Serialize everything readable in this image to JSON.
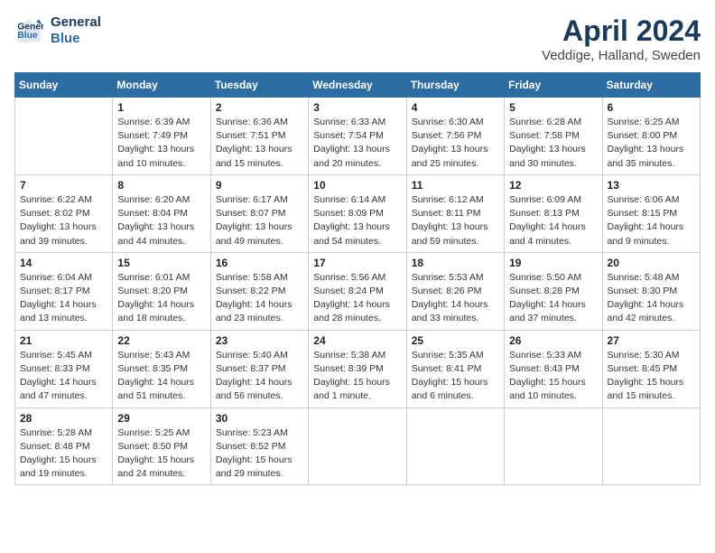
{
  "header": {
    "logo_line1": "General",
    "logo_line2": "Blue",
    "month_title": "April 2024",
    "location": "Veddige, Halland, Sweden"
  },
  "weekdays": [
    "Sunday",
    "Monday",
    "Tuesday",
    "Wednesday",
    "Thursday",
    "Friday",
    "Saturday"
  ],
  "weeks": [
    [
      {
        "day": "",
        "info": ""
      },
      {
        "day": "1",
        "info": "Sunrise: 6:39 AM\nSunset: 7:49 PM\nDaylight: 13 hours\nand 10 minutes."
      },
      {
        "day": "2",
        "info": "Sunrise: 6:36 AM\nSunset: 7:51 PM\nDaylight: 13 hours\nand 15 minutes."
      },
      {
        "day": "3",
        "info": "Sunrise: 6:33 AM\nSunset: 7:54 PM\nDaylight: 13 hours\nand 20 minutes."
      },
      {
        "day": "4",
        "info": "Sunrise: 6:30 AM\nSunset: 7:56 PM\nDaylight: 13 hours\nand 25 minutes."
      },
      {
        "day": "5",
        "info": "Sunrise: 6:28 AM\nSunset: 7:58 PM\nDaylight: 13 hours\nand 30 minutes."
      },
      {
        "day": "6",
        "info": "Sunrise: 6:25 AM\nSunset: 8:00 PM\nDaylight: 13 hours\nand 35 minutes."
      }
    ],
    [
      {
        "day": "7",
        "info": "Sunrise: 6:22 AM\nSunset: 8:02 PM\nDaylight: 13 hours\nand 39 minutes."
      },
      {
        "day": "8",
        "info": "Sunrise: 6:20 AM\nSunset: 8:04 PM\nDaylight: 13 hours\nand 44 minutes."
      },
      {
        "day": "9",
        "info": "Sunrise: 6:17 AM\nSunset: 8:07 PM\nDaylight: 13 hours\nand 49 minutes."
      },
      {
        "day": "10",
        "info": "Sunrise: 6:14 AM\nSunset: 8:09 PM\nDaylight: 13 hours\nand 54 minutes."
      },
      {
        "day": "11",
        "info": "Sunrise: 6:12 AM\nSunset: 8:11 PM\nDaylight: 13 hours\nand 59 minutes."
      },
      {
        "day": "12",
        "info": "Sunrise: 6:09 AM\nSunset: 8:13 PM\nDaylight: 14 hours\nand 4 minutes."
      },
      {
        "day": "13",
        "info": "Sunrise: 6:06 AM\nSunset: 8:15 PM\nDaylight: 14 hours\nand 9 minutes."
      }
    ],
    [
      {
        "day": "14",
        "info": "Sunrise: 6:04 AM\nSunset: 8:17 PM\nDaylight: 14 hours\nand 13 minutes."
      },
      {
        "day": "15",
        "info": "Sunrise: 6:01 AM\nSunset: 8:20 PM\nDaylight: 14 hours\nand 18 minutes."
      },
      {
        "day": "16",
        "info": "Sunrise: 5:58 AM\nSunset: 8:22 PM\nDaylight: 14 hours\nand 23 minutes."
      },
      {
        "day": "17",
        "info": "Sunrise: 5:56 AM\nSunset: 8:24 PM\nDaylight: 14 hours\nand 28 minutes."
      },
      {
        "day": "18",
        "info": "Sunrise: 5:53 AM\nSunset: 8:26 PM\nDaylight: 14 hours\nand 33 minutes."
      },
      {
        "day": "19",
        "info": "Sunrise: 5:50 AM\nSunset: 8:28 PM\nDaylight: 14 hours\nand 37 minutes."
      },
      {
        "day": "20",
        "info": "Sunrise: 5:48 AM\nSunset: 8:30 PM\nDaylight: 14 hours\nand 42 minutes."
      }
    ],
    [
      {
        "day": "21",
        "info": "Sunrise: 5:45 AM\nSunset: 8:33 PM\nDaylight: 14 hours\nand 47 minutes."
      },
      {
        "day": "22",
        "info": "Sunrise: 5:43 AM\nSunset: 8:35 PM\nDaylight: 14 hours\nand 51 minutes."
      },
      {
        "day": "23",
        "info": "Sunrise: 5:40 AM\nSunset: 8:37 PM\nDaylight: 14 hours\nand 56 minutes."
      },
      {
        "day": "24",
        "info": "Sunrise: 5:38 AM\nSunset: 8:39 PM\nDaylight: 15 hours\nand 1 minute."
      },
      {
        "day": "25",
        "info": "Sunrise: 5:35 AM\nSunset: 8:41 PM\nDaylight: 15 hours\nand 6 minutes."
      },
      {
        "day": "26",
        "info": "Sunrise: 5:33 AM\nSunset: 8:43 PM\nDaylight: 15 hours\nand 10 minutes."
      },
      {
        "day": "27",
        "info": "Sunrise: 5:30 AM\nSunset: 8:45 PM\nDaylight: 15 hours\nand 15 minutes."
      }
    ],
    [
      {
        "day": "28",
        "info": "Sunrise: 5:28 AM\nSunset: 8:48 PM\nDaylight: 15 hours\nand 19 minutes."
      },
      {
        "day": "29",
        "info": "Sunrise: 5:25 AM\nSunset: 8:50 PM\nDaylight: 15 hours\nand 24 minutes."
      },
      {
        "day": "30",
        "info": "Sunrise: 5:23 AM\nSunset: 8:52 PM\nDaylight: 15 hours\nand 29 minutes."
      },
      {
        "day": "",
        "info": ""
      },
      {
        "day": "",
        "info": ""
      },
      {
        "day": "",
        "info": ""
      },
      {
        "day": "",
        "info": ""
      }
    ]
  ]
}
